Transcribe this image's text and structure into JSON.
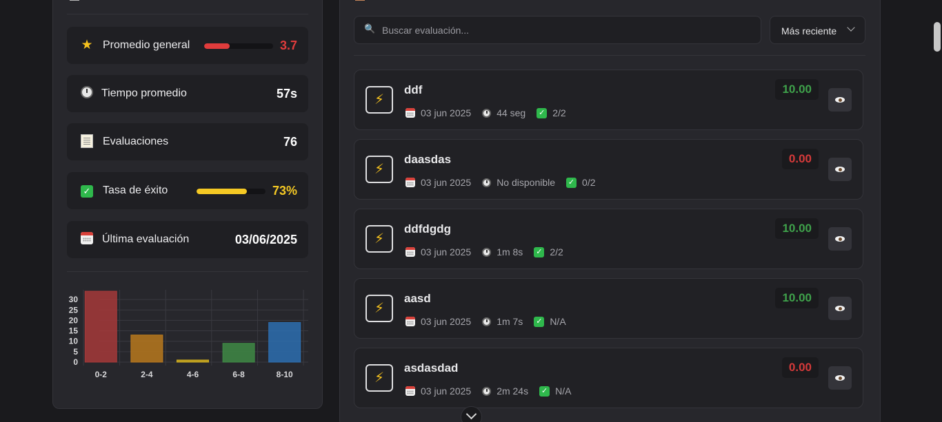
{
  "stats": {
    "promedio": {
      "label": "Promedio general",
      "value": "3.7",
      "bar_fraction": 0.37
    },
    "tiempo": {
      "label": "Tiempo promedio",
      "value": "57s"
    },
    "evaluaciones": {
      "label": "Evaluaciones",
      "value": "76"
    },
    "exito": {
      "label": "Tasa de éxito",
      "value": "73%",
      "bar_fraction": 0.73
    },
    "ultima": {
      "label": "Última evaluación",
      "value": "03/06/2025"
    }
  },
  "chart_data": {
    "type": "bar",
    "categories": [
      "0-2",
      "2-4",
      "4-6",
      "6-8",
      "8-10"
    ],
    "values": [
      34,
      13,
      1,
      9,
      19
    ],
    "colors": [
      "#a63a3a",
      "#b9791d",
      "#d4b21e",
      "#3f8a45",
      "#2d6fb0"
    ],
    "ylim": [
      0,
      34
    ],
    "yticks": [
      0,
      5,
      10,
      15,
      20,
      25,
      30
    ],
    "grid": true
  },
  "search": {
    "placeholder": "Buscar evaluación..."
  },
  "sort": {
    "label": "Más reciente"
  },
  "evaluations": [
    {
      "name": "ddf",
      "date": "03 jun 2025",
      "duration": "44 seg",
      "correct": "2/2",
      "score": "10.00",
      "score_color": "#3fa24b"
    },
    {
      "name": "daasdas",
      "date": "03 jun 2025",
      "duration": "No disponible",
      "correct": "0/2",
      "score": "0.00",
      "score_color": "#d63a3a"
    },
    {
      "name": "ddfdgdg",
      "date": "03 jun 2025",
      "duration": "1m 8s",
      "correct": "2/2",
      "score": "10.00",
      "score_color": "#3fa24b"
    },
    {
      "name": "aasd",
      "date": "03 jun 2025",
      "duration": "1m 7s",
      "correct": "N/A",
      "score": "10.00",
      "score_color": "#3fa24b"
    },
    {
      "name": "asdasdad",
      "date": "03 jun 2025",
      "duration": "2m 24s",
      "correct": "N/A",
      "score": "0.00",
      "score_color": "#d63a3a"
    }
  ],
  "icons": {
    "star": "★",
    "bolt": "⚡",
    "check": "✓",
    "search": "🔍"
  },
  "accents": {
    "danger": "#e03c3c",
    "warning": "#f5c924",
    "success": "#3fa24b"
  }
}
